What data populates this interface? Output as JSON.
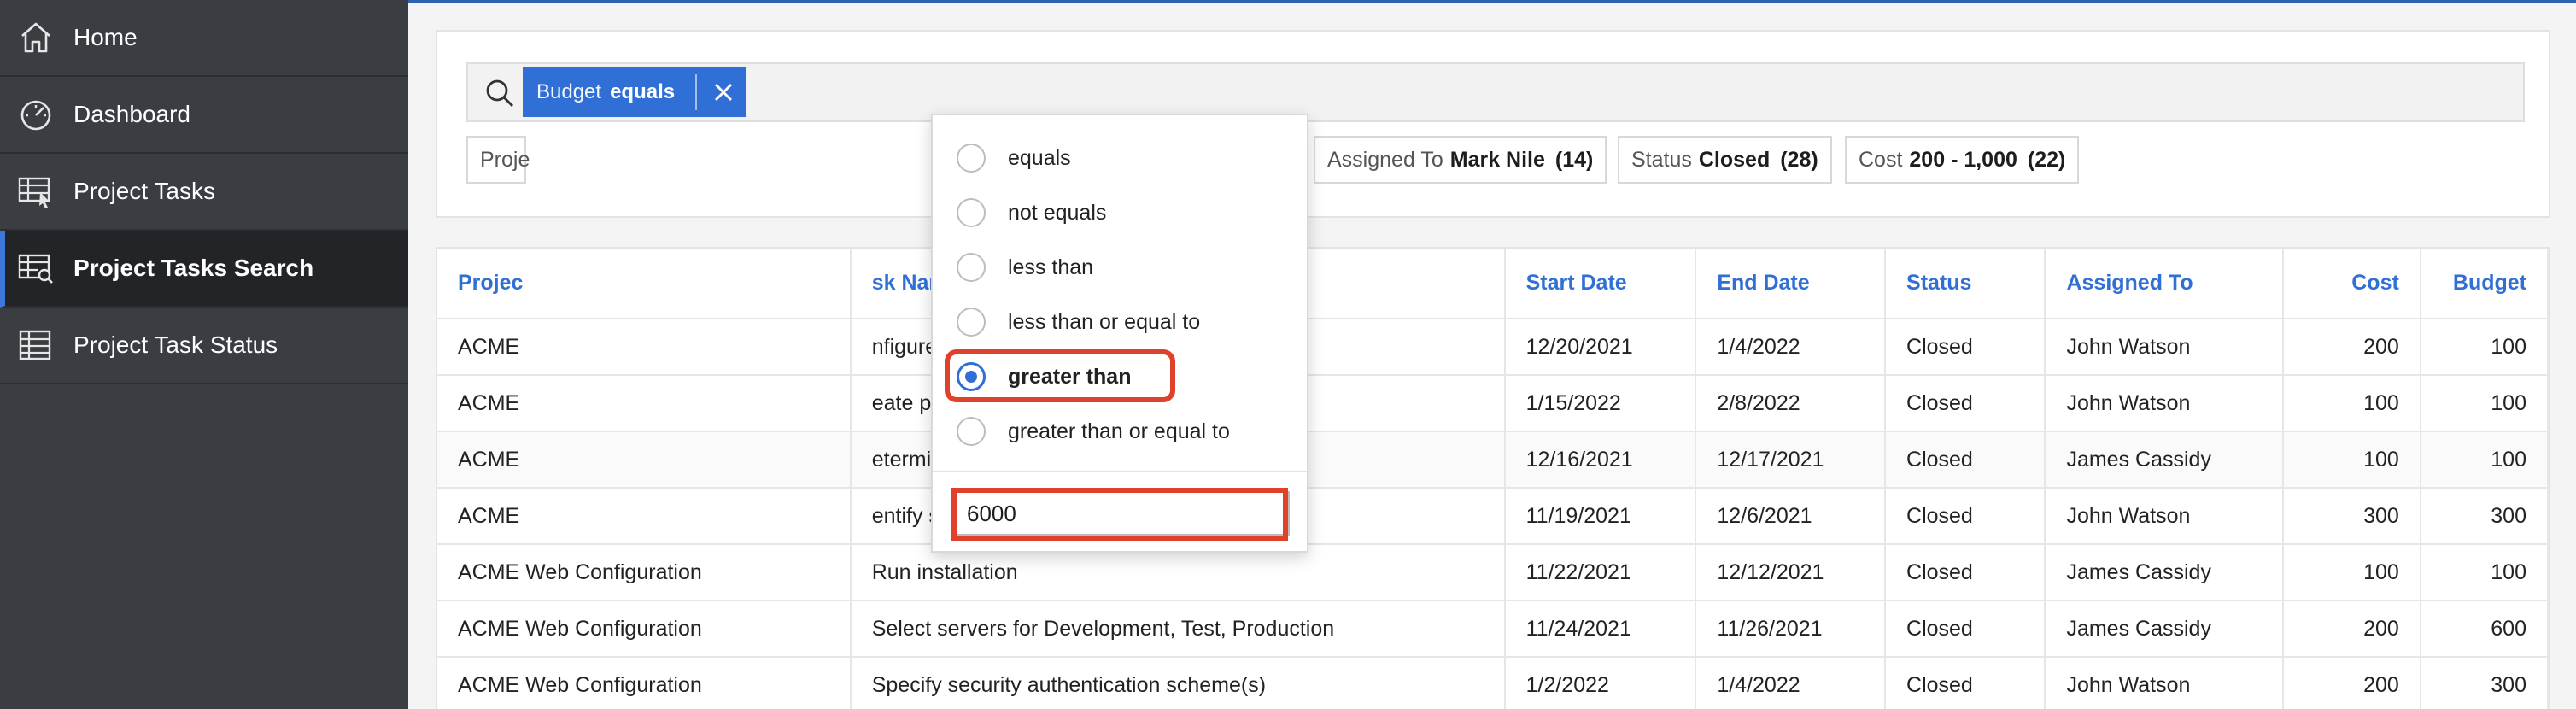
{
  "sidebar": {
    "items": [
      {
        "label": "Home",
        "icon": "home-icon"
      },
      {
        "label": "Dashboard",
        "icon": "dashboard-icon"
      },
      {
        "label": "Project Tasks",
        "icon": "table-cursor-icon"
      },
      {
        "label": "Project Tasks Search",
        "icon": "table-search-icon",
        "active": true
      },
      {
        "label": "Project Task Status",
        "icon": "table-icon"
      }
    ]
  },
  "search": {
    "active_facet": {
      "name": "Budget",
      "operator": "equals"
    },
    "chips": [
      {
        "name": "Proje",
        "value": ""
      },
      {
        "name": "Assigned To",
        "value": "Mark Nile",
        "count": "(14)"
      },
      {
        "name": "Status",
        "value": "Closed",
        "count": "(28)"
      },
      {
        "name": "Cost",
        "value": "200 - 1,000",
        "count": "(22)"
      }
    ]
  },
  "popup": {
    "options": [
      "equals",
      "not equals",
      "less than",
      "less than or equal to",
      "greater than",
      "greater than or equal to"
    ],
    "selected": "greater than",
    "value": "6000"
  },
  "table": {
    "columns": [
      "Projec",
      "sk Name",
      "Start Date",
      "End Date",
      "Status",
      "Assigned To",
      "Cost",
      "Budget"
    ],
    "rows": [
      [
        "ACME",
        "nfigure Workspace provisioning",
        "12/20/2021",
        "1/4/2022",
        "Closed",
        "John Watson",
        "200",
        "100"
      ],
      [
        "ACME",
        "eate pilot workspace",
        "1/15/2022",
        "2/8/2022",
        "Closed",
        "John Watson",
        "100",
        "100"
      ],
      [
        "ACME",
        "etermine Web listener configuration(s)",
        "12/16/2021",
        "12/17/2021",
        "Closed",
        "James Cassidy",
        "100",
        "100"
      ],
      [
        "ACME",
        "entify server requirements",
        "11/19/2021",
        "12/6/2021",
        "Closed",
        "John Watson",
        "300",
        "300"
      ],
      [
        "ACME Web Configuration",
        "Run installation",
        "11/22/2021",
        "12/12/2021",
        "Closed",
        "James Cassidy",
        "100",
        "100"
      ],
      [
        "ACME Web Configuration",
        "Select servers for Development, Test, Production",
        "11/24/2021",
        "11/26/2021",
        "Closed",
        "James Cassidy",
        "200",
        "600"
      ],
      [
        "ACME Web Configuration",
        "Specify security authentication scheme(s)",
        "1/2/2022",
        "1/4/2022",
        "Closed",
        "John Watson",
        "200",
        "300"
      ]
    ]
  },
  "colors": {
    "accent": "#2f6fd6",
    "sidebar": "#3a3d42",
    "highlight": "#e0412b"
  }
}
